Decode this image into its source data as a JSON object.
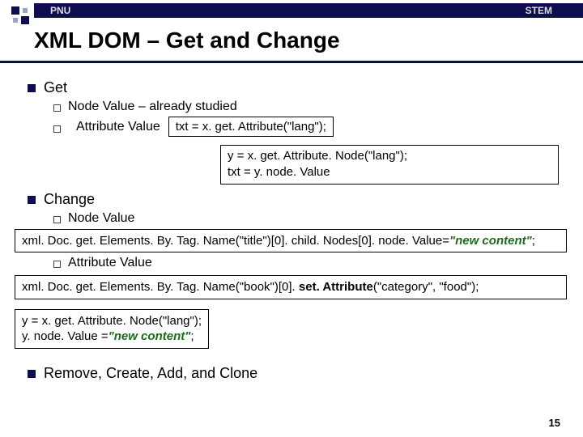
{
  "hdr": {
    "left": "PNU",
    "right": "STEM"
  },
  "title": "XML DOM – Get and Change",
  "sec1": {
    "label": "Get",
    "node_value": "Node Value – already studied",
    "attr_value": "Attribute Value",
    "code_inline": "txt = x. get. Attribute(\"lang\");",
    "code_block_l1": "y = x. get. Attribute. Node(\"lang\");",
    "code_block_l2": "txt = y. node. Value"
  },
  "sec2": {
    "label": "Change",
    "node_value": "Node Value",
    "attr_value": "Attribute Value",
    "wide1_pre": "xml. Doc. get. Elements. By. Tag. Name(\"title\")[0]. child. Nodes[0]. node. Value=",
    "wide1_str": "\"new content\"",
    "wide1_post": ";",
    "wide2_pre": "xml. Doc. get. Elements. By. Tag. Name(\"book\")[0]. ",
    "wide2_bold": "set. Attribute",
    "wide2_post": "(\"category\", \"food\");",
    "box_l1": "y = x. get. Attribute. Node(\"lang\");",
    "box_l2a": "y. node. Value =",
    "box_l2b": "\"new content\"",
    "box_l2c": ";"
  },
  "sec3": {
    "label": "Remove, Create, Add, and Clone"
  },
  "page": "15"
}
